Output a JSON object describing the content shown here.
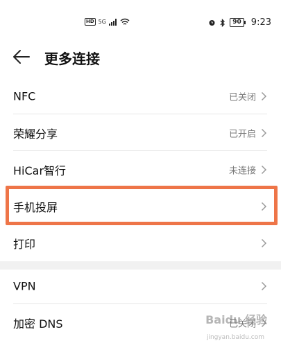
{
  "status_bar": {
    "hd_badge": "HD",
    "network_type": "5G",
    "battery_level": "90",
    "time": "9:23"
  },
  "header": {
    "title": "更多连接"
  },
  "settings": [
    {
      "label": "NFC",
      "value": "已关闭"
    },
    {
      "label": "荣耀分享",
      "value": "已开启"
    },
    {
      "label": "HiCar智行",
      "value": "未连接"
    },
    {
      "label": "手机投屏",
      "value": ""
    },
    {
      "label": "打印",
      "value": ""
    },
    {
      "label": "VPN",
      "value": ""
    },
    {
      "label": "加密 DNS",
      "value": "已关闭"
    }
  ],
  "watermark": {
    "text": "Baidu 经验",
    "sub": "jingyan.baidu.com"
  },
  "colors": {
    "highlight": "#ee7548",
    "value_text": "#7a7a7a"
  }
}
